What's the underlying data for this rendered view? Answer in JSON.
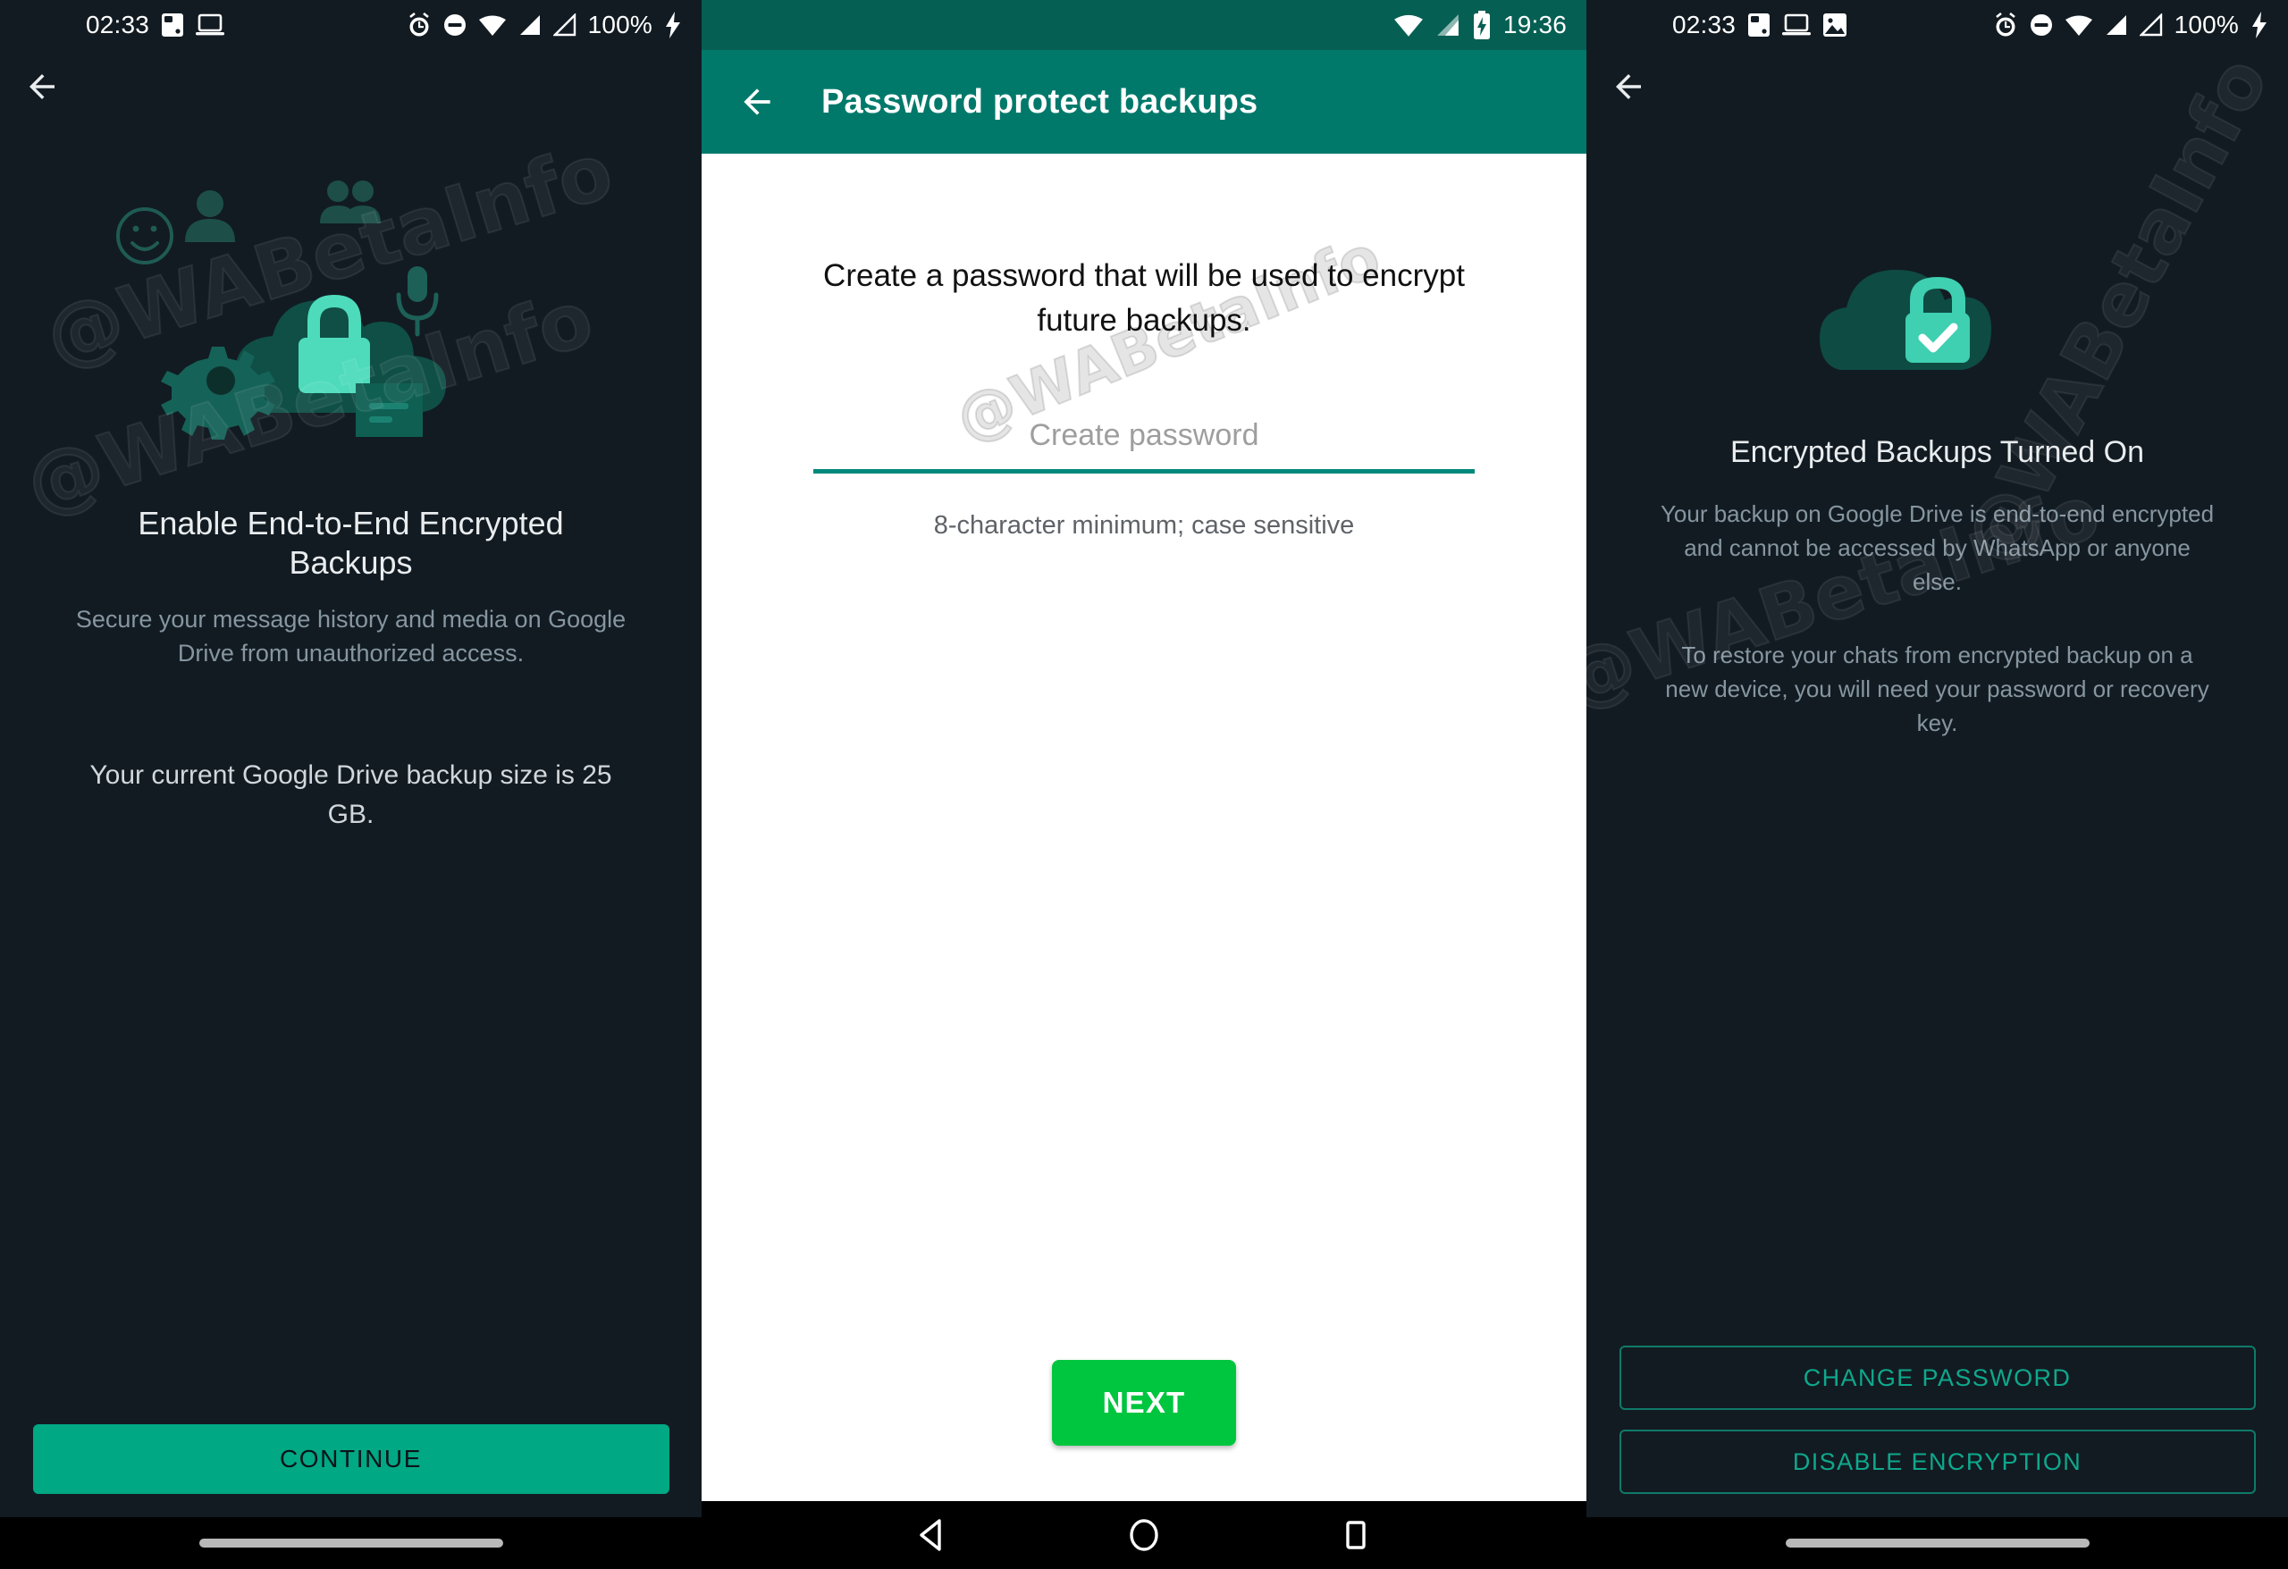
{
  "watermark": {
    "dark_text": "@WABetaInfo",
    "light_text": "@WABetaInfo"
  },
  "colors": {
    "dark_bg": "#121b22",
    "accent_teal": "#00a884",
    "appbar_green": "#00796b",
    "statusbar_green": "#065f53",
    "next_green": "#00c63f",
    "outline_teal": "#0ea88c",
    "title_text": "#e9edef",
    "body_text": "#8696a0"
  },
  "panel1": {
    "status": {
      "time": "02:33",
      "icons_left": [
        "sd-card-icon",
        "laptop-icon"
      ],
      "icons_right": [
        "alarm-icon",
        "do-not-disturb-icon",
        "wifi-icon",
        "signal-icon",
        "signal-2-icon"
      ],
      "battery_percent": "100%",
      "charging_icon": "bolt-icon"
    },
    "back_label": "back-arrow",
    "illustration": "cloud-with-lock-and-chat-icons",
    "title": "Enable End-to-End Encrypted Backups",
    "subtitle": "Secure your message history and media on Google Drive from unauthorized access.",
    "backup_size_text": "Your current Google Drive backup size is 25 GB.",
    "continue_label": "CONTINUE"
  },
  "panel2": {
    "status": {
      "time": "19:36",
      "icons_right": [
        "wifi-icon",
        "signal-icon",
        "battery-charging-icon"
      ]
    },
    "appbar_title": "Password protect backups",
    "description": "Create a password that will be used to encrypt future backups.",
    "password_placeholder": "Create password",
    "password_value": "",
    "hint": "8-character minimum; case sensitive",
    "next_label": "NEXT",
    "navbar": [
      "back-triangle-icon",
      "home-circle-icon",
      "recents-square-icon"
    ]
  },
  "panel3": {
    "status": {
      "time": "02:33",
      "icons_left": [
        "sd-card-icon",
        "laptop-icon",
        "image-icon"
      ],
      "icons_right": [
        "alarm-icon",
        "do-not-disturb-icon",
        "wifi-icon",
        "signal-icon",
        "signal-2-icon"
      ],
      "battery_percent": "100%",
      "charging_icon": "bolt-icon"
    },
    "back_label": "back-arrow",
    "illustration": "cloud-with-locked-check-icon",
    "title": "Encrypted Backups Turned On",
    "paragraph1": "Your backup on Google Drive is end-to-end encrypted and cannot be accessed by WhatsApp or anyone else.",
    "paragraph2": "To restore your chats from encrypted backup on a new device, you will need your password or recovery key.",
    "change_password_label": "CHANGE PASSWORD",
    "disable_encryption_label": "DISABLE ENCRYPTION"
  }
}
